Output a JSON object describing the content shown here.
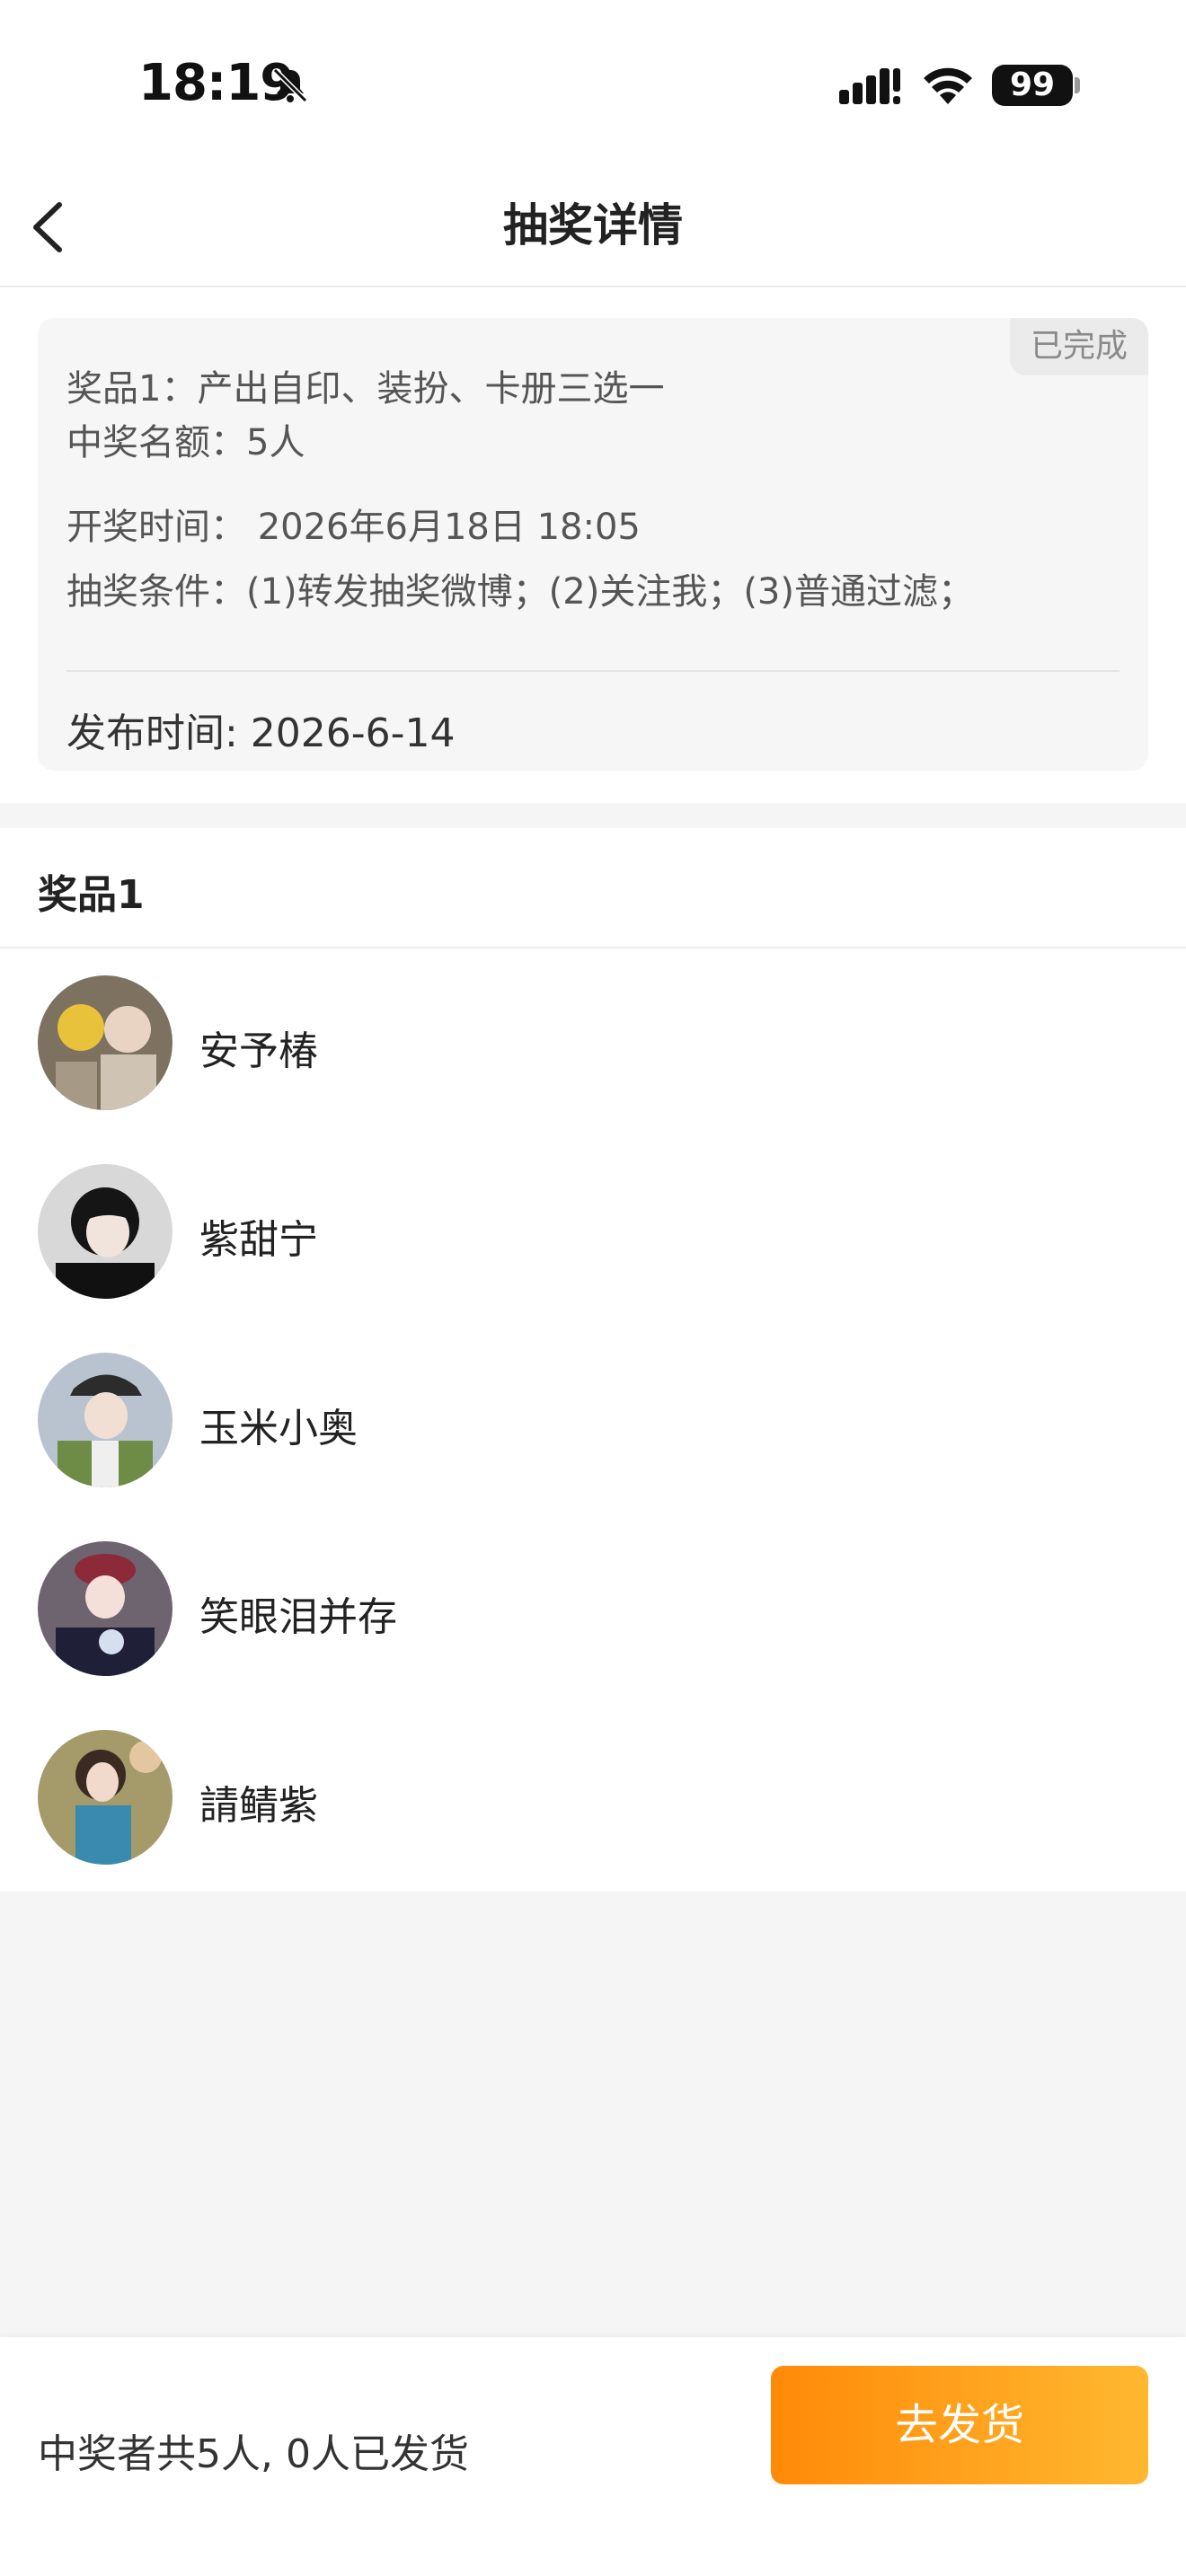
{
  "status_bar": {
    "time": "18:19",
    "battery": "99"
  },
  "header": {
    "title": "抽奖详情"
  },
  "info": {
    "status_badge": "已完成",
    "prize": "奖品1：产出自印、装扮、卡册三选一",
    "quota": "中奖名额：5人",
    "draw_time": "开奖时间：  2026年6月18日 18:05",
    "conditions": "抽奖条件：(1)转发抽奖微博；(2)关注我；(3)普通过滤；",
    "publish_time": "发布时间: 2026-6-14"
  },
  "winners": {
    "title": "奖品1",
    "list": [
      {
        "name": "安予椿",
        "avatar_color": "#8a7a5e"
      },
      {
        "name": "紫甜宁",
        "avatar_color": "#1c1c1c"
      },
      {
        "name": "玉米小奥",
        "avatar_color": "#6b8b4a"
      },
      {
        "name": "笑眼泪并存",
        "avatar_color": "#4a3a55"
      },
      {
        "name": "請鲭紫",
        "avatar_color": "#c08a6a"
      }
    ]
  },
  "footer": {
    "summary": "中奖者共5人, 0人已发货",
    "ship_button": "去发货"
  },
  "colors": {
    "accent_start": "#ff8a08",
    "accent_end": "#ffb830",
    "background": "#f5f5f5"
  }
}
